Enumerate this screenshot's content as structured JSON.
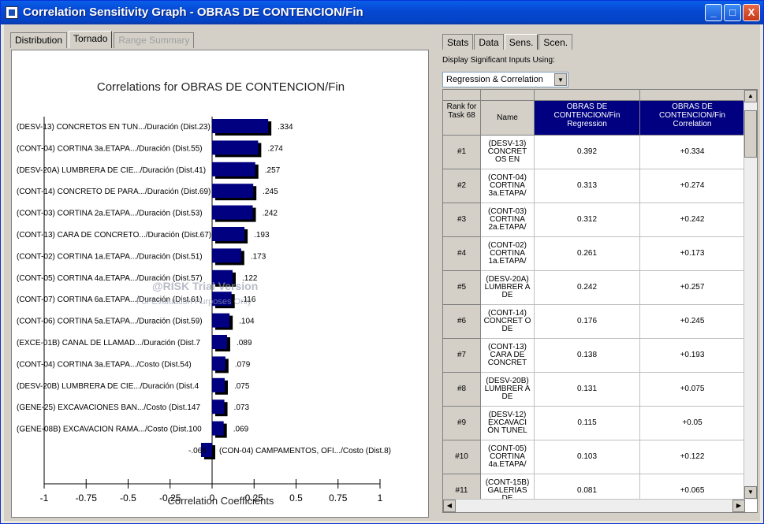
{
  "window": {
    "title": "Correlation Sensitivity Graph - OBRAS DE CONTENCION/Fin",
    "buttons": [
      "_",
      "□",
      "X"
    ]
  },
  "left_tabs": [
    "Distribution",
    "Tornado",
    "Range Summary"
  ],
  "left_active_tab": "Tornado",
  "graph": {
    "watermark_line1": "@RISK Trial Version",
    "watermark_line2": "For Evaluation Purposes Only"
  },
  "chart_data": {
    "type": "bar",
    "title": "Correlations for OBRAS DE CONTENCION/Fin",
    "xlabel": "Correlation Coefficients",
    "ylabel": "",
    "xlim": [
      -1,
      1
    ],
    "xticks": [
      "-1",
      "-0.75",
      "-0.5",
      "-0.25",
      "0",
      "0.25",
      "0.5",
      "0.75",
      "1"
    ],
    "categories": [
      "(DESV-13) CONCRETOS EN TUN.../Duración (Dist.23)",
      "(CONT-04) CORTINA 3a.ETAPA.../Duración (Dist.55)",
      "(DESV-20A) LUMBRERA DE CIE.../Duración (Dist.41)",
      "(CONT-14) CONCRETO DE PARA.../Duración (Dist.69)",
      "(CONT-03) CORTINA 2a.ETAPA.../Duración (Dist.53)",
      "(CONT-13) CARA DE CONCRETO.../Duración (Dist.67)",
      "(CONT-02) CORTINA 1a.ETAPA.../Duración (Dist.51)",
      "(CONT-05) CORTINA 4a.ETAPA.../Duración (Dist.57)",
      "(CONT-07) CORTINA 6a.ETAPA.../Duración (Dist.61)",
      "(CONT-06) CORTINA 5a.ETAPA.../Duración (Dist.59)",
      "(EXCE-01B) CANAL DE LLAMAD.../Duración (Dist.7",
      "(CONT-04) CORTINA 3a.ETAPA.../Costo (Dist.54)",
      "(DESV-20B) LUMBRERA DE CIE.../Duración (Dist.4",
      "(GENE-25) EXCAVACIONES BAN.../Costo (Dist.147",
      "(GENE-08B) EXCAVACION RAMA.../Costo (Dist.100",
      "(CON-04) CAMPAMENTOS, OFI.../Costo (Dist.8)"
    ],
    "values": [
      0.334,
      0.274,
      0.257,
      0.245,
      0.242,
      0.193,
      0.173,
      0.122,
      0.116,
      0.104,
      0.089,
      0.079,
      0.075,
      0.073,
      0.069,
      -0.066
    ],
    "value_labels": [
      ".334",
      ".274",
      ".257",
      ".245",
      ".242",
      ".193",
      ".173",
      ".122",
      ".116",
      ".104",
      ".089",
      ".079",
      ".075",
      ".073",
      ".069",
      "-.066"
    ],
    "colors": {
      "bar": "#000080",
      "shadow": "#000000"
    }
  },
  "right_tabs": [
    "Stats",
    "Data",
    "Sens.",
    "Scen."
  ],
  "right_active_tab": "Sens.",
  "sig_label": "Display Significant Inputs Using:",
  "sig_select": "Regression & Correlation",
  "table": {
    "headers": {
      "rank": "Rank for Task 68",
      "name": "Name",
      "regression": "OBRAS DE CONTENCION/Fin Regression",
      "correlation": "OBRAS DE CONTENCION/Fin Correlation"
    },
    "rows": [
      {
        "rank": "#1",
        "name": "(DESV-13) CONCRET OS EN",
        "regression": "0.392",
        "correlation": "+0.334"
      },
      {
        "rank": "#2",
        "name": "(CONT-04) CORTINA 3a.ETAPA/",
        "regression": "0.313",
        "correlation": "+0.274"
      },
      {
        "rank": "#3",
        "name": "(CONT-03) CORTINA 2a.ETAPA/",
        "regression": "0.312",
        "correlation": "+0.242"
      },
      {
        "rank": "#4",
        "name": "(CONT-02) CORTINA 1a.ETAPA/",
        "regression": "0.261",
        "correlation": "+0.173"
      },
      {
        "rank": "#5",
        "name": "(DESV-20A) LUMBRER A DE",
        "regression": "0.242",
        "correlation": "+0.257"
      },
      {
        "rank": "#6",
        "name": "(CONT-14) CONCRET O DE",
        "regression": "0.176",
        "correlation": "+0.245"
      },
      {
        "rank": "#7",
        "name": "(CONT-13) CARA DE CONCRET",
        "regression": "0.138",
        "correlation": "+0.193"
      },
      {
        "rank": "#8",
        "name": "(DESV-20B) LUMBRER A DE",
        "regression": "0.131",
        "correlation": "+0.075"
      },
      {
        "rank": "#9",
        "name": "(DESV-12) EXCAVACI ÓN TUNEL",
        "regression": "0.115",
        "correlation": "+0.05"
      },
      {
        "rank": "#10",
        "name": "(CONT-05) CORTINA 4a.ETAPA/",
        "regression": "0.103",
        "correlation": "+0.122"
      },
      {
        "rank": "#11",
        "name": "(CONT-15B) GALERÍAS DE",
        "regression": "0.081",
        "correlation": "+0.065"
      }
    ]
  }
}
